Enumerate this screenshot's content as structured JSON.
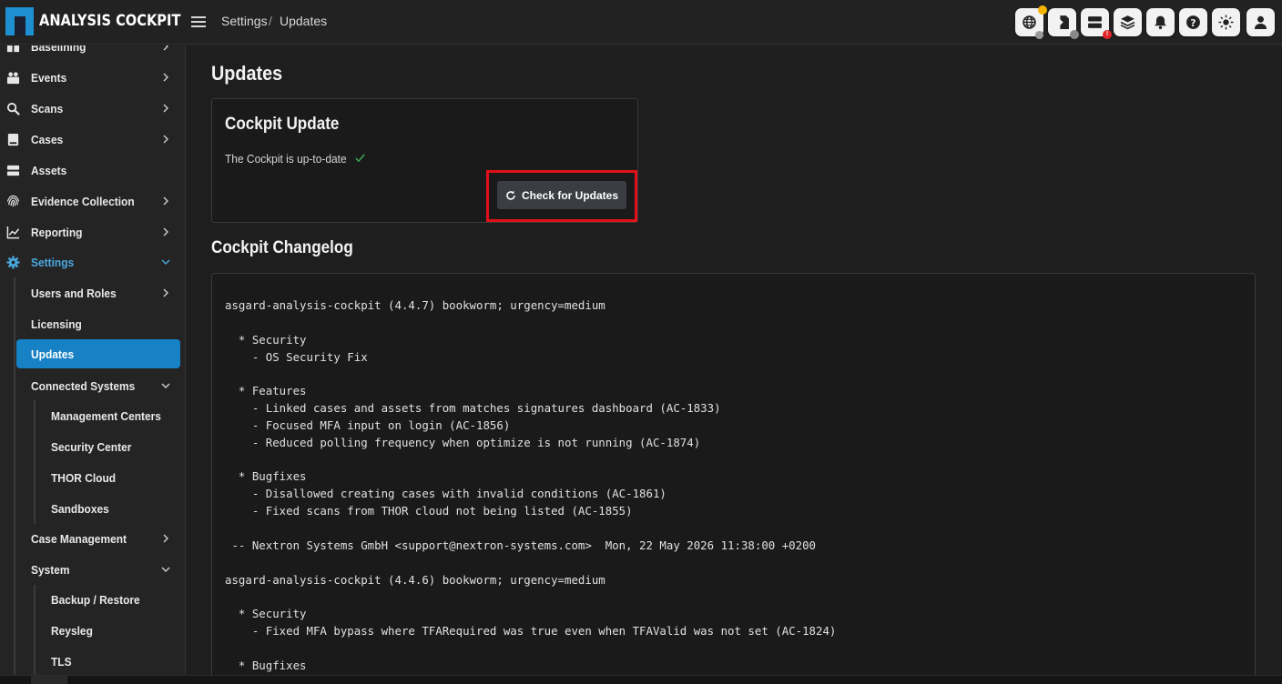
{
  "app": {
    "name": "ANALYSIS COCKPIT"
  },
  "breadcrumb": {
    "section": "Settings",
    "separator": "/",
    "page": "Updates"
  },
  "toolbar": {
    "icons": [
      "globe-icon",
      "import-icon",
      "server-icon",
      "layers-icon",
      "bell-icon",
      "help-icon",
      "sun-icon",
      "user-icon"
    ],
    "colors": {
      "status_yellow": "#f5b400",
      "status_gray": "#8a8a8a",
      "alert_red": "#e0262a"
    },
    "alert_badge": "!"
  },
  "sidebar": {
    "items": [
      {
        "label": "Baselining",
        "icon": "book-icon"
      },
      {
        "label": "Events",
        "icon": "events-icon"
      },
      {
        "label": "Scans",
        "icon": "scan-icon"
      },
      {
        "label": "Cases",
        "icon": "folder-icon"
      },
      {
        "label": "Assets",
        "icon": "server-icon"
      },
      {
        "label": "Evidence Collection",
        "icon": "fingerprint-icon"
      },
      {
        "label": "Reporting",
        "icon": "chart-icon"
      },
      {
        "label": "Settings",
        "icon": "gear-icon"
      },
      {
        "label": "Users and Roles"
      },
      {
        "label": "Licensing"
      },
      {
        "label": "Updates"
      },
      {
        "label": "Connected Systems"
      },
      {
        "label": "Management Centers"
      },
      {
        "label": "Security Center"
      },
      {
        "label": "THOR Cloud"
      },
      {
        "label": "Sandboxes"
      },
      {
        "label": "Case Management"
      },
      {
        "label": "System"
      },
      {
        "label": "Backup / Restore"
      },
      {
        "label": "Reysleg"
      },
      {
        "label": "TLS"
      }
    ],
    "colors": {
      "active_bg": "#1681c4",
      "accent": "#4aa8e0"
    }
  },
  "main": {
    "title": "Updates",
    "update_card": {
      "title": "Cockpit Update",
      "status": "The Cockpit is up-to-date",
      "status_icon": "check-icon",
      "button_label": "Check for Updates",
      "button_icon": "refresh-icon",
      "highlight_color": "#e21018"
    },
    "changelog_title": "Cockpit Changelog",
    "changelog_lines": [
      "asgard-analysis-cockpit (4.4.7) bookworm; urgency=medium",
      "",
      "  * Security",
      "    - OS Security Fix",
      "",
      "  * Features",
      "    - Linked cases and assets from matches signatures dashboard (AC-1833)",
      "    - Focused MFA input on login (AC-1856)",
      "    - Reduced polling frequency when optimize is not running (AC-1874)",
      "",
      "  * Bugfixes",
      "    - Disallowed creating cases with invalid conditions (AC-1861)",
      "    - Fixed scans from THOR cloud not being listed (AC-1855)",
      "",
      " -- Nextron Systems GmbH <support@nextron-systems.com>  Mon, 22 May 2026 11:38:00 +0200",
      "",
      "asgard-analysis-cockpit (4.4.6) bookworm; urgency=medium",
      "",
      "  * Security",
      "    - Fixed MFA bypass where TFARequired was true even when TFAValid was not set (AC-1824)",
      "",
      "  * Bugfixes"
    ]
  }
}
